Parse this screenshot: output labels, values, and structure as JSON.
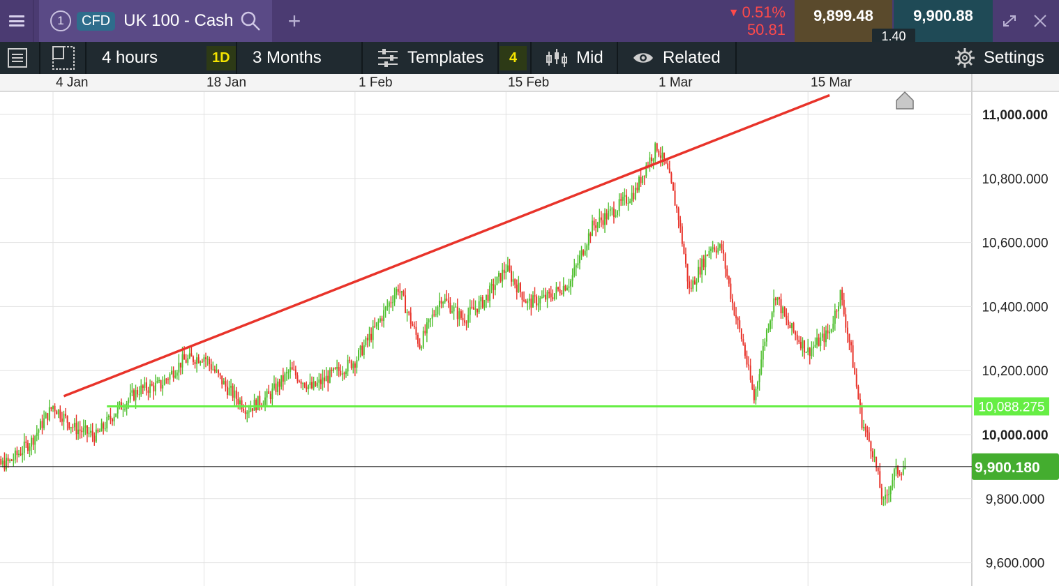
{
  "topbar": {
    "menu_icon": "hamburger-menu-icon",
    "workspace_number": "1",
    "instrument_type": "CFD",
    "instrument_name": "UK 100 - Cash",
    "change_percent": "0.51%",
    "change_points": "50.81",
    "sell_price": "9,899.48",
    "buy_price": "9,900.88",
    "spread": "1.40",
    "colors": {
      "down": "#ff4a4a",
      "sell_bg": "#5a4a2c",
      "buy_bg": "#1f4a56",
      "header_bg": "#4b3b72"
    }
  },
  "toolbar": {
    "interval_label": "4 hours",
    "candle_period_badge": "1D",
    "range_label": "3 Months",
    "templates_label": "Templates",
    "indicator_count": "4",
    "price_mode_label": "Mid",
    "related_label": "Related",
    "settings_label": "Settings"
  },
  "chart_data": {
    "type": "candlestick",
    "instrument": "UK 100 - Cash",
    "x_tick_labels": [
      "4 Jan",
      "18 Jan",
      "1 Feb",
      "15 Feb",
      "1 Mar",
      "15 Mar"
    ],
    "y_tick_labels": [
      "11,000.000",
      "10,800.000",
      "10,600.000",
      "10,400.000",
      "10,200.000",
      "10,000.000",
      "9,800.000",
      "9,600.000"
    ],
    "ylim": [
      9560,
      11080
    ],
    "grid": true,
    "colors": {
      "up": "#4fbf2f",
      "down": "#e8332a"
    },
    "close_path": [
      [
        "28 Dec",
        9880
      ],
      [
        "31 Dec",
        9915
      ],
      [
        "2 Jan",
        9980
      ],
      [
        "4 Jan",
        10090
      ],
      [
        "6 Jan",
        10020
      ],
      [
        "8 Jan",
        9995
      ],
      [
        "10 Jan",
        10080
      ],
      [
        "12 Jan",
        10140
      ],
      [
        "14 Jan",
        10155
      ],
      [
        "16 Jan",
        10230
      ],
      [
        "18 Jan",
        10245
      ],
      [
        "20 Jan",
        10150
      ],
      [
        "22 Jan",
        10080
      ],
      [
        "24 Jan",
        10120
      ],
      [
        "26 Jan",
        10200
      ],
      [
        "28 Jan",
        10145
      ],
      [
        "30 Jan",
        10190
      ],
      [
        "1 Feb",
        10230
      ],
      [
        "3 Feb",
        10340
      ],
      [
        "5 Feb",
        10460
      ],
      [
        "7 Feb",
        10280
      ],
      [
        "9 Feb",
        10430
      ],
      [
        "11 Feb",
        10360
      ],
      [
        "13 Feb",
        10420
      ],
      [
        "15 Feb",
        10520
      ],
      [
        "17 Feb",
        10410
      ],
      [
        "19 Feb",
        10430
      ],
      [
        "21 Feb",
        10480
      ],
      [
        "23 Feb",
        10650
      ],
      [
        "25 Feb",
        10700
      ],
      [
        "27 Feb",
        10760
      ],
      [
        "28 Feb",
        10840
      ],
      [
        "1 Mar",
        10900
      ],
      [
        "2 Mar",
        10820
      ],
      [
        "3 Mar",
        10680
      ],
      [
        "4 Mar",
        10450
      ],
      [
        "6 Mar",
        10590
      ],
      [
        "7 Mar",
        10580
      ],
      [
        "8 Mar",
        10410
      ],
      [
        "9 Mar",
        10280
      ],
      [
        "10 Mar",
        10110
      ],
      [
        "11 Mar",
        10300
      ],
      [
        "12 Mar",
        10440
      ],
      [
        "13 Mar",
        10350
      ],
      [
        "15 Mar",
        10260
      ],
      [
        "17 Mar",
        10320
      ],
      [
        "18 Mar",
        10440
      ],
      [
        "19 Mar",
        10260
      ],
      [
        "20 Mar",
        10040
      ],
      [
        "21 Mar",
        9950
      ],
      [
        "22 Mar",
        9780
      ],
      [
        "23 Mar",
        9880
      ],
      [
        "24 Mar",
        9900
      ]
    ],
    "lines": [
      {
        "name": "trendline",
        "color": "#e8332a",
        "from": [
          "5 Jan",
          10120
        ],
        "to": [
          "17 Mar",
          11060
        ]
      },
      {
        "name": "support",
        "color": "#66ee44",
        "from": [
          "9 Jan",
          10088.275
        ],
        "to": [
          "right-edge",
          10088.275
        ],
        "label": "10,088.275"
      },
      {
        "name": "current-price",
        "color": "#222222",
        "value": 9900.18,
        "label": "9,900.180"
      }
    ]
  }
}
